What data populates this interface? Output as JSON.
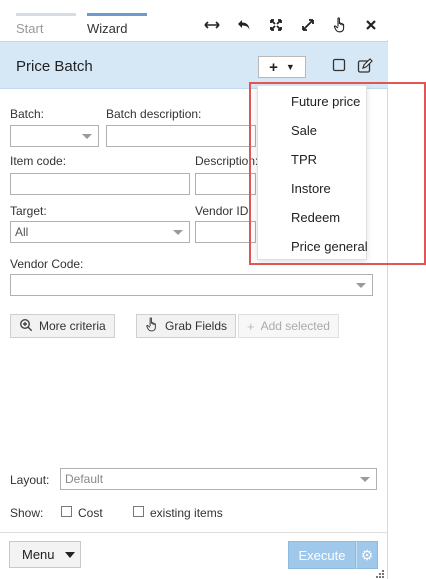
{
  "tabs": {
    "start": "Start",
    "wizard": "Wizard"
  },
  "toolbar_icons": [
    "resize-horizontal-icon",
    "undo-icon",
    "expand-icon",
    "fullscreen-icon",
    "pointer-icon",
    "close-icon"
  ],
  "header": {
    "title": "Price Batch",
    "add_label": "+"
  },
  "form": {
    "batch_label": "Batch:",
    "batch_value": "",
    "batch_description_label": "Batch description:",
    "item_code_label": "Item code:",
    "description_label": "Description:",
    "target_label": "Target:",
    "target_value": "All",
    "vendor_id_label": "Vendor ID:",
    "vendor_code_label": "Vendor Code:"
  },
  "actions": {
    "more_criteria": "More criteria",
    "grab_fields": "Grab Fields",
    "add_selected": "Add selected"
  },
  "layout": {
    "label": "Layout:",
    "value": "Default"
  },
  "show": {
    "label": "Show:",
    "cost": "Cost",
    "existing_items": "existing items"
  },
  "footer": {
    "menu": "Menu",
    "execute": "Execute"
  },
  "dropdown_menu": [
    "Future price",
    "Sale",
    "TPR",
    "Instore",
    "Redeem",
    "Price general"
  ],
  "colors": {
    "header_bg": "#d6e8f6",
    "accent": "#6b9bd1",
    "execute_bg": "#9fc8ea",
    "highlight": "#e05555"
  }
}
